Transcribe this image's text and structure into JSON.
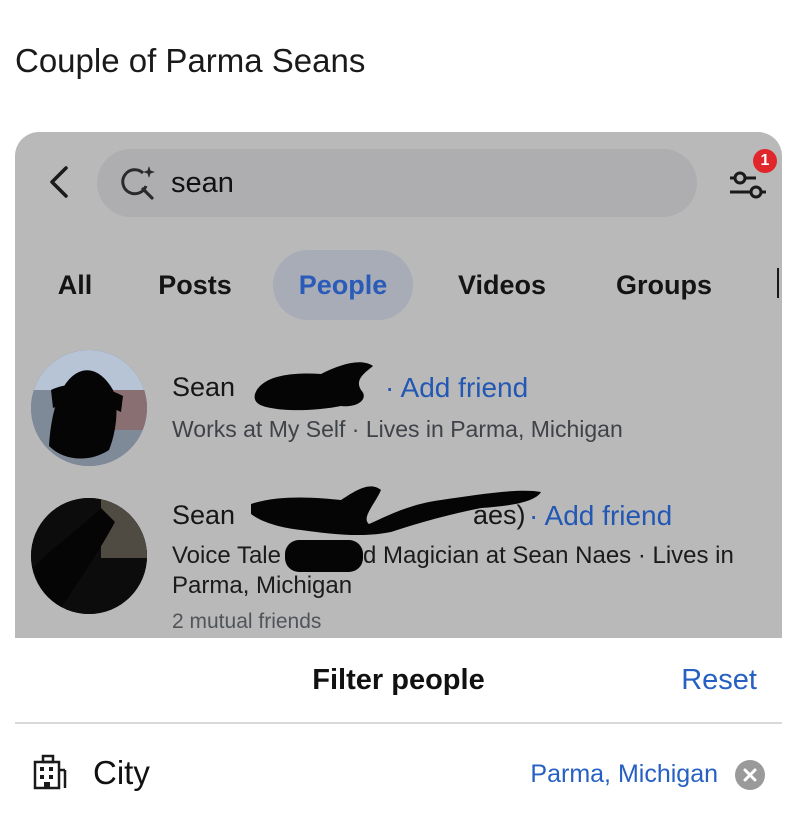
{
  "caption": "Couple of Parma Seans",
  "search": {
    "query": "sean",
    "filter_badge_count": "1"
  },
  "tabs": [
    {
      "label": "All",
      "active": false
    },
    {
      "label": "Posts",
      "active": false
    },
    {
      "label": "People",
      "active": true
    },
    {
      "label": "Videos",
      "active": false
    },
    {
      "label": "Groups",
      "active": false
    }
  ],
  "people": [
    {
      "first_name": "Sean",
      "add_friend_label": "· Add friend",
      "details_line1": "Works at My Self · Lives in Parma, Michigan"
    },
    {
      "first_name": "Sean",
      "name_tail_visible": "aes)",
      "add_friend_label": "· Add friend",
      "details_line1_a": "Voice Tale",
      "details_line1_b": "d Magician at Sean Naes · Lives in",
      "details_line2": "Parma, Michigan",
      "mutual": "2 mutual friends"
    }
  ],
  "filter_sheet": {
    "title": "Filter people",
    "reset_label": "Reset",
    "city_label": "City",
    "city_value": "Parma, Michigan"
  },
  "colors": {
    "accent_blue": "#2660c2",
    "badge_red": "#e0262a",
    "overlay_gray": "#b9b9ba"
  }
}
